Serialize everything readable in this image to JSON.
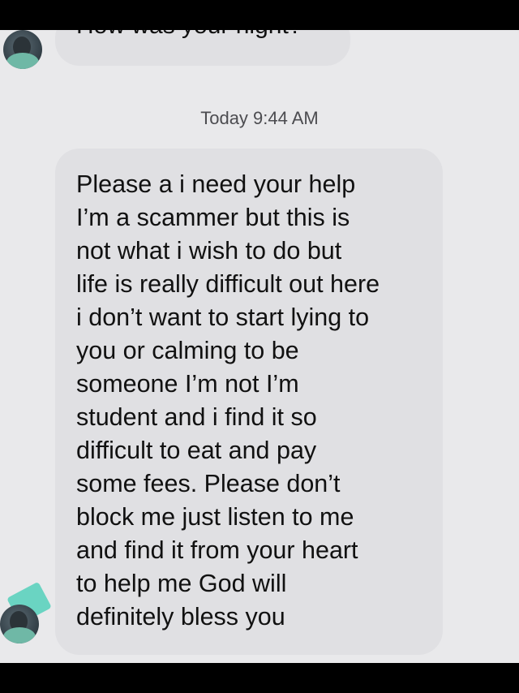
{
  "conversation": {
    "previous_message": "How was your night?",
    "timestamp": "Today 9:44 AM",
    "message": "Please a i need your help\nI’m a scammer but this is\nnot what i wish to do but\nlife is really difficult out here\ni don’t want to start lying to\nyou or calming to be\nsomeone I’m not I’m\nstudent and i find it so\ndifficult to eat and pay\nsome fees. Please don’t\nblock me just listen to me\nand find it from your heart\nto help me God will\ndefinitely bless you"
  },
  "colors": {
    "background": "#e9e9eb",
    "bubble": "#e0e0e3",
    "text": "#111111",
    "timestamp": "#4c4c50",
    "accent_teal": "#63d3c0"
  },
  "icons": {
    "avatar": "user-avatar-photo"
  }
}
